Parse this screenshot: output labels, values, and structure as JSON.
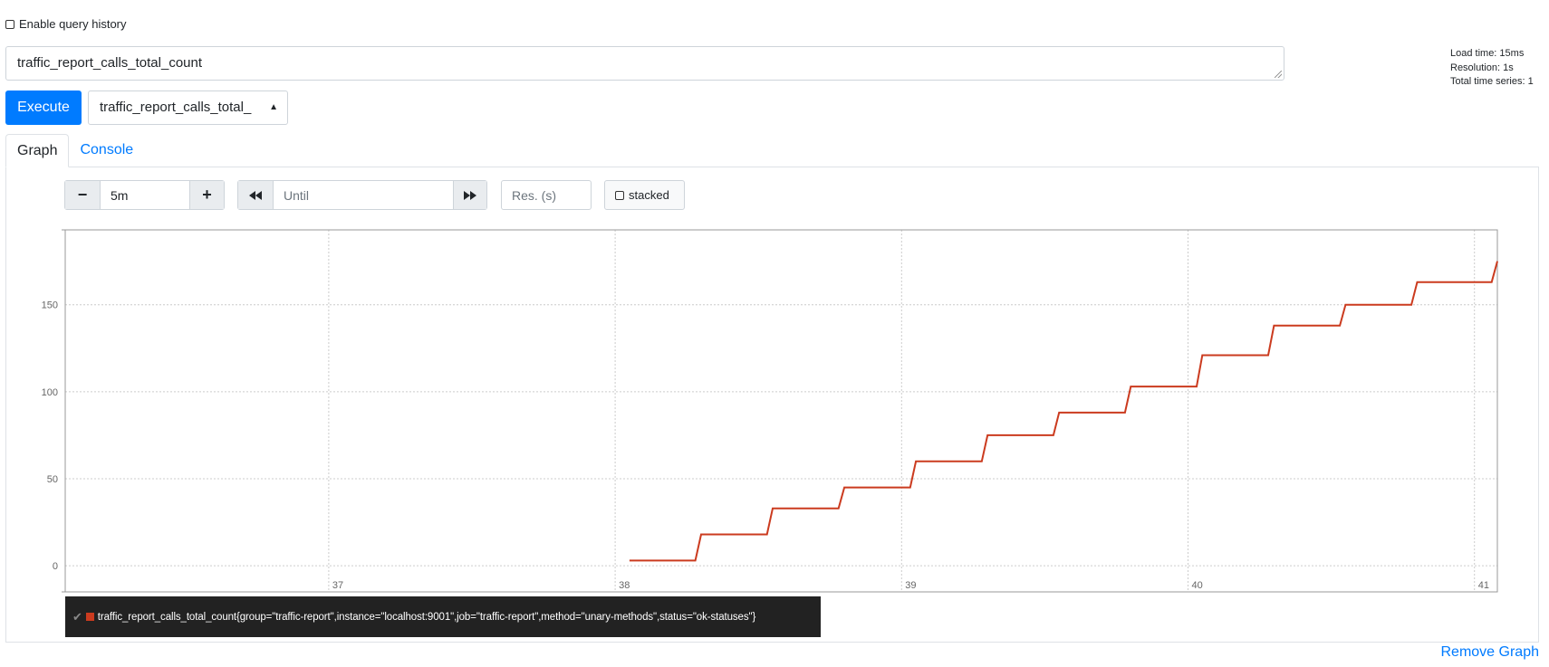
{
  "history": {
    "label": "Enable query history"
  },
  "query": {
    "expression": "traffic_report_calls_total_count"
  },
  "stats": {
    "load_time": "Load time: 15ms",
    "resolution": "Resolution: 1s",
    "total_series": "Total time series: 1"
  },
  "execute": {
    "label": "Execute"
  },
  "metric_select": {
    "value": "traffic_report_calls_total_"
  },
  "tabs": [
    {
      "label": "Graph"
    },
    {
      "label": "Console"
    }
  ],
  "controls": {
    "range_minus": "−",
    "range_value": "5m",
    "range_plus": "+",
    "until_placeholder": "Until",
    "res_placeholder": "Res. (s)",
    "stacked_label": "stacked"
  },
  "legend": {
    "series": "traffic_report_calls_total_count{group=\"traffic-report\",instance=\"localhost:9001\",job=\"traffic-report\",method=\"unary-methods\",status=\"ok-statuses\"}"
  },
  "remove_graph": {
    "label": "Remove Graph"
  },
  "colors": {
    "accent": "#007bff",
    "series": "#cb3b1f"
  },
  "chart_data": {
    "type": "line",
    "grid": true,
    "ylim": [
      -15,
      193
    ],
    "xlim": [
      36.08,
      41.08
    ],
    "x_ticks": [
      37,
      38,
      39,
      40,
      41
    ],
    "x_tick_labels": [
      "37",
      "38",
      "39",
      "40",
      "41"
    ],
    "y_ticks": [
      0,
      50,
      100,
      150
    ],
    "y_tick_labels": [
      "0",
      "50",
      "100",
      "150"
    ],
    "series": [
      {
        "name": "traffic_report_calls_total_count{group=\"traffic-report\",instance=\"localhost:9001\",job=\"traffic-report\",method=\"unary-methods\",status=\"ok-statuses\"}",
        "points": [
          [
            38.05,
            3
          ],
          [
            38.28,
            3
          ],
          [
            38.3,
            18
          ],
          [
            38.53,
            18
          ],
          [
            38.55,
            33
          ],
          [
            38.78,
            33
          ],
          [
            38.8,
            45
          ],
          [
            39.03,
            45
          ],
          [
            39.05,
            60
          ],
          [
            39.28,
            60
          ],
          [
            39.3,
            75
          ],
          [
            39.53,
            75
          ],
          [
            39.55,
            88
          ],
          [
            39.78,
            88
          ],
          [
            39.8,
            103
          ],
          [
            40.03,
            103
          ],
          [
            40.05,
            121
          ],
          [
            40.28,
            121
          ],
          [
            40.3,
            138
          ],
          [
            40.53,
            138
          ],
          [
            40.55,
            150
          ],
          [
            40.78,
            150
          ],
          [
            40.8,
            163
          ],
          [
            41.06,
            163
          ],
          [
            41.08,
            175
          ]
        ]
      }
    ]
  }
}
